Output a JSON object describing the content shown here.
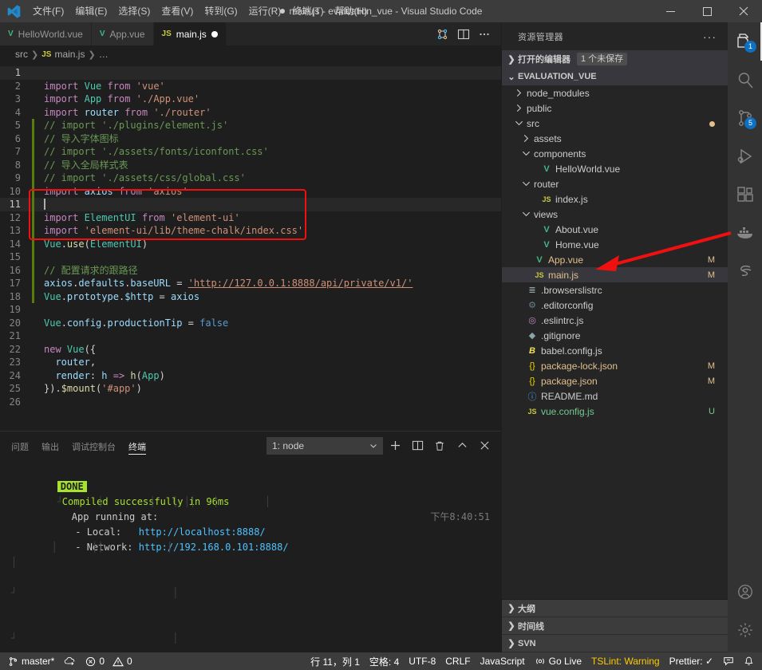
{
  "titlebar": {
    "logo_icon": "vscode-logo-icon",
    "menus": [
      {
        "label": "文件(F)",
        "name": "menu-file"
      },
      {
        "label": "编辑(E)",
        "name": "menu-edit"
      },
      {
        "label": "选择(S)",
        "name": "menu-selection"
      },
      {
        "label": "查看(V)",
        "name": "menu-view"
      },
      {
        "label": "转到(G)",
        "name": "menu-go"
      },
      {
        "label": "运行(R)",
        "name": "menu-run"
      },
      {
        "label": "终端(T)",
        "name": "menu-terminal"
      },
      {
        "label": "帮助(H)",
        "name": "menu-help"
      }
    ],
    "window_title": "main.js - evaluation_vue - Visual Studio Code",
    "minimize_label": "—",
    "maximize_label": "▢",
    "close_label": "✕"
  },
  "tabs": [
    {
      "label": "HelloWorld.vue",
      "type": "vue",
      "type_label": "V",
      "active": false,
      "dirty": false
    },
    {
      "label": "App.vue",
      "type": "vue",
      "type_label": "V",
      "active": false,
      "dirty": false
    },
    {
      "label": "main.js",
      "type": "js",
      "type_label": "JS",
      "active": true,
      "dirty": true
    }
  ],
  "tabbar_actions": [
    {
      "name": "run-and-debug-icon",
      "label": "⑂"
    },
    {
      "name": "split-editor-icon",
      "label": "▯"
    },
    {
      "name": "more-actions-icon",
      "label": "···"
    }
  ],
  "breadcrumb": {
    "items": [
      "src",
      "main.js",
      "…"
    ],
    "file_type_label": "JS",
    "separator": "❯"
  },
  "editor": {
    "language": "JavaScript",
    "lines": [
      {
        "n": 1,
        "mark": "none",
        "current": true,
        "tokens": []
      },
      {
        "n": 2,
        "mark": "none",
        "tokens": [
          {
            "t": "kw",
            "v": "import"
          },
          {
            "t": "op",
            "v": " "
          },
          {
            "t": "cls",
            "v": "Vue"
          },
          {
            "t": "op",
            "v": " "
          },
          {
            "t": "kw",
            "v": "from"
          },
          {
            "t": "op",
            "v": " "
          },
          {
            "t": "str",
            "v": "'vue'"
          }
        ]
      },
      {
        "n": 3,
        "mark": "none",
        "tokens": [
          {
            "t": "kw",
            "v": "import"
          },
          {
            "t": "op",
            "v": " "
          },
          {
            "t": "cls",
            "v": "App"
          },
          {
            "t": "op",
            "v": " "
          },
          {
            "t": "kw",
            "v": "from"
          },
          {
            "t": "op",
            "v": " "
          },
          {
            "t": "str",
            "v": "'./App.vue'"
          }
        ]
      },
      {
        "n": 4,
        "mark": "none",
        "tokens": [
          {
            "t": "kw",
            "v": "import"
          },
          {
            "t": "op",
            "v": " "
          },
          {
            "t": "id",
            "v": "router"
          },
          {
            "t": "op",
            "v": " "
          },
          {
            "t": "kw",
            "v": "from"
          },
          {
            "t": "op",
            "v": " "
          },
          {
            "t": "str",
            "v": "'./router'"
          }
        ]
      },
      {
        "n": 5,
        "mark": "green",
        "tokens": [
          {
            "t": "cmt",
            "v": "// import './plugins/element.js'"
          }
        ]
      },
      {
        "n": 6,
        "mark": "green",
        "tokens": [
          {
            "t": "cmt",
            "v": "// 导入字体图标"
          }
        ]
      },
      {
        "n": 7,
        "mark": "green",
        "tokens": [
          {
            "t": "cmt",
            "v": "// import './assets/fonts/iconfont.css'"
          }
        ]
      },
      {
        "n": 8,
        "mark": "green",
        "tokens": [
          {
            "t": "cmt",
            "v": "// 导入全局样式表"
          }
        ]
      },
      {
        "n": 9,
        "mark": "green",
        "tokens": [
          {
            "t": "cmt",
            "v": "// import './assets/css/global.css'"
          }
        ]
      },
      {
        "n": 10,
        "mark": "green",
        "tokens": [
          {
            "t": "kw",
            "v": "import"
          },
          {
            "t": "op",
            "v": " "
          },
          {
            "t": "id",
            "v": "axios"
          },
          {
            "t": "op",
            "v": " "
          },
          {
            "t": "kw",
            "v": "from"
          },
          {
            "t": "op",
            "v": " "
          },
          {
            "t": "str",
            "v": "'axios'"
          }
        ]
      },
      {
        "n": 11,
        "mark": "green",
        "current": true,
        "tokens": []
      },
      {
        "n": 12,
        "mark": "green",
        "tokens": [
          {
            "t": "kw",
            "v": "import"
          },
          {
            "t": "op",
            "v": " "
          },
          {
            "t": "cls",
            "v": "ElementUI"
          },
          {
            "t": "op",
            "v": " "
          },
          {
            "t": "kw",
            "v": "from"
          },
          {
            "t": "op",
            "v": " "
          },
          {
            "t": "str",
            "v": "'element-ui'"
          }
        ]
      },
      {
        "n": 13,
        "mark": "green",
        "tokens": [
          {
            "t": "kw",
            "v": "import"
          },
          {
            "t": "op",
            "v": " "
          },
          {
            "t": "str",
            "v": "'element-ui/lib/theme-chalk/index.css'"
          }
        ]
      },
      {
        "n": 14,
        "mark": "green",
        "tokens": [
          {
            "t": "cls",
            "v": "Vue"
          },
          {
            "t": "op",
            "v": "."
          },
          {
            "t": "fn",
            "v": "use"
          },
          {
            "t": "op",
            "v": "("
          },
          {
            "t": "cls",
            "v": "ElementUI"
          },
          {
            "t": "op",
            "v": ")"
          }
        ]
      },
      {
        "n": 15,
        "mark": "green",
        "tokens": []
      },
      {
        "n": 16,
        "mark": "green",
        "tokens": [
          {
            "t": "cmt",
            "v": "// 配置请求的跟路径"
          }
        ]
      },
      {
        "n": 17,
        "mark": "green",
        "tokens": [
          {
            "t": "id",
            "v": "axios"
          },
          {
            "t": "op",
            "v": "."
          },
          {
            "t": "prop",
            "v": "defaults"
          },
          {
            "t": "op",
            "v": "."
          },
          {
            "t": "prop",
            "v": "baseURL"
          },
          {
            "t": "op",
            "v": " = "
          },
          {
            "t": "link",
            "v": "'http://127.0.0.1:8888/api/private/v1/'"
          }
        ]
      },
      {
        "n": 18,
        "mark": "green",
        "tokens": [
          {
            "t": "cls",
            "v": "Vue"
          },
          {
            "t": "op",
            "v": "."
          },
          {
            "t": "prop",
            "v": "prototype"
          },
          {
            "t": "op",
            "v": "."
          },
          {
            "t": "prop",
            "v": "$http"
          },
          {
            "t": "op",
            "v": " = "
          },
          {
            "t": "id",
            "v": "axios"
          }
        ]
      },
      {
        "n": 19,
        "mark": "none",
        "tokens": []
      },
      {
        "n": 20,
        "mark": "none",
        "tokens": [
          {
            "t": "cls",
            "v": "Vue"
          },
          {
            "t": "op",
            "v": "."
          },
          {
            "t": "prop",
            "v": "config"
          },
          {
            "t": "op",
            "v": "."
          },
          {
            "t": "prop",
            "v": "productionTip"
          },
          {
            "t": "op",
            "v": " = "
          },
          {
            "t": "kw2",
            "v": "false"
          }
        ]
      },
      {
        "n": 21,
        "mark": "none",
        "tokens": []
      },
      {
        "n": 22,
        "mark": "none",
        "tokens": [
          {
            "t": "kw",
            "v": "new"
          },
          {
            "t": "op",
            "v": " "
          },
          {
            "t": "cls",
            "v": "Vue"
          },
          {
            "t": "op",
            "v": "({"
          }
        ]
      },
      {
        "n": 23,
        "mark": "none",
        "tokens": [
          {
            "t": "op",
            "v": "  "
          },
          {
            "t": "id",
            "v": "router"
          },
          {
            "t": "op",
            "v": ","
          }
        ]
      },
      {
        "n": 24,
        "mark": "none",
        "tokens": [
          {
            "t": "op",
            "v": "  "
          },
          {
            "t": "prop",
            "v": "render"
          },
          {
            "t": "op",
            "v": ": "
          },
          {
            "t": "id",
            "v": "h"
          },
          {
            "t": "op",
            "v": " "
          },
          {
            "t": "kw",
            "v": "=>"
          },
          {
            "t": "op",
            "v": " "
          },
          {
            "t": "fn",
            "v": "h"
          },
          {
            "t": "op",
            "v": "("
          },
          {
            "t": "cls",
            "v": "App"
          },
          {
            "t": "op",
            "v": ")"
          }
        ]
      },
      {
        "n": 25,
        "mark": "none",
        "tokens": [
          {
            "t": "op",
            "v": "})."
          },
          {
            "t": "fn",
            "v": "$mount"
          },
          {
            "t": "op",
            "v": "("
          },
          {
            "t": "str",
            "v": "'#app'"
          },
          {
            "t": "op",
            "v": ")"
          }
        ]
      },
      {
        "n": 26,
        "mark": "none",
        "tokens": []
      }
    ],
    "highlight_annotation": {
      "color": "#f01010",
      "from_line": 11,
      "to_line": 15
    }
  },
  "sidebar": {
    "title": "资源管理器",
    "more_label": "···",
    "open_editors": {
      "label": "打开的编辑器",
      "badge": "1 个未保存",
      "chevron": "❯"
    },
    "workspace": {
      "label": "EVALUATION_VUE",
      "chevron": "⌄"
    },
    "tree": [
      {
        "name": "node_modules",
        "indent": 1,
        "kind": "folder",
        "open": false,
        "icon": "folder-icon"
      },
      {
        "name": "public",
        "indent": 1,
        "kind": "folder",
        "open": false,
        "icon": "folder-icon"
      },
      {
        "name": "src",
        "indent": 1,
        "kind": "folder",
        "open": true,
        "icon": "folder-icon",
        "dot": true
      },
      {
        "name": "assets",
        "indent": 2,
        "kind": "folder",
        "open": false,
        "icon": "folder-icon"
      },
      {
        "name": "components",
        "indent": 2,
        "kind": "folder",
        "open": true,
        "icon": "folder-icon"
      },
      {
        "name": "HelloWorld.vue",
        "indent": 3,
        "kind": "file",
        "icon": "vue-file-icon",
        "icon_label": "V"
      },
      {
        "name": "router",
        "indent": 2,
        "kind": "folder",
        "open": true,
        "icon": "folder-icon"
      },
      {
        "name": "index.js",
        "indent": 3,
        "kind": "file",
        "icon": "js-file-icon",
        "icon_label": "JS"
      },
      {
        "name": "views",
        "indent": 2,
        "kind": "folder",
        "open": true,
        "icon": "folder-icon"
      },
      {
        "name": "About.vue",
        "indent": 3,
        "kind": "file",
        "icon": "vue-file-icon",
        "icon_label": "V"
      },
      {
        "name": "Home.vue",
        "indent": 3,
        "kind": "file",
        "icon": "vue-file-icon",
        "icon_label": "V"
      },
      {
        "name": "App.vue",
        "indent": 2,
        "kind": "file",
        "icon": "vue-file-icon",
        "icon_label": "V",
        "status": "M",
        "status_color": "modified"
      },
      {
        "name": "main.js",
        "indent": 2,
        "kind": "file",
        "icon": "js-file-icon",
        "icon_label": "JS",
        "status": "M",
        "status_color": "modified",
        "selected": true
      },
      {
        "name": ".browserslistrc",
        "indent": 1,
        "kind": "file",
        "icon": "list-file-icon",
        "icon_label": "≣"
      },
      {
        "name": ".editorconfig",
        "indent": 1,
        "kind": "file",
        "icon": "gear-file-icon",
        "icon_label": "⚙"
      },
      {
        "name": ".eslintrc.js",
        "indent": 1,
        "kind": "file",
        "icon": "eslint-file-icon",
        "icon_label": "◎"
      },
      {
        "name": ".gitignore",
        "indent": 1,
        "kind": "file",
        "icon": "git-file-icon",
        "icon_label": "◆"
      },
      {
        "name": "babel.config.js",
        "indent": 1,
        "kind": "file",
        "icon": "babel-file-icon",
        "icon_label": "B"
      },
      {
        "name": "package-lock.json",
        "indent": 1,
        "kind": "file",
        "icon": "json-file-icon",
        "icon_label": "{}",
        "status": "M",
        "status_color": "modified"
      },
      {
        "name": "package.json",
        "indent": 1,
        "kind": "file",
        "icon": "json-file-icon",
        "icon_label": "{}",
        "status": "M",
        "status_color": "modified"
      },
      {
        "name": "README.md",
        "indent": 1,
        "kind": "file",
        "icon": "info-file-icon",
        "icon_label": "ⓘ"
      },
      {
        "name": "vue.config.js",
        "indent": 1,
        "kind": "file",
        "icon": "js-file-icon",
        "icon_label": "JS",
        "status": "U",
        "status_color": "untracked"
      }
    ],
    "bottom_panels": [
      {
        "label": "大纲",
        "chevron": "❯",
        "name": "outline-panel"
      },
      {
        "label": "时间线",
        "chevron": "❯",
        "name": "timeline-panel"
      },
      {
        "label": "SVN",
        "chevron": "❯",
        "name": "svn-panel"
      }
    ]
  },
  "activitybar": {
    "items": [
      {
        "name": "explorer-icon",
        "badge": "1",
        "active": true
      },
      {
        "name": "search-icon",
        "badge": null,
        "active": false
      },
      {
        "name": "source-control-icon",
        "badge": "5",
        "active": false
      },
      {
        "name": "run-and-debug-icon",
        "badge": null,
        "active": false
      },
      {
        "name": "extensions-icon",
        "badge": null,
        "active": false
      },
      {
        "name": "docker-icon",
        "badge": null,
        "active": false
      },
      {
        "name": "sass-icon",
        "badge": null,
        "active": false
      }
    ],
    "bottom_items": [
      {
        "name": "accounts-icon"
      },
      {
        "name": "settings-gear-icon"
      }
    ]
  },
  "panel": {
    "tabs": [
      {
        "label": "问题",
        "active": false,
        "name": "tab-problems"
      },
      {
        "label": "输出",
        "active": false,
        "name": "tab-output"
      },
      {
        "label": "调试控制台",
        "active": false,
        "name": "tab-debug-console"
      },
      {
        "label": "终端",
        "active": true,
        "name": "tab-terminal"
      }
    ],
    "terminal_select": {
      "value": "1: node",
      "chevron": "⌄"
    },
    "actions": [
      {
        "name": "new-terminal-icon",
        "label": "+"
      },
      {
        "name": "split-terminal-icon",
        "label": "▯"
      },
      {
        "name": "kill-terminal-icon",
        "label": "🗑"
      },
      {
        "name": "maximize-panel-icon",
        "label": "^"
      },
      {
        "name": "close-panel-icon",
        "label": "✕"
      }
    ],
    "terminal": {
      "done_badge": "DONE",
      "compiled_message": "Compiled successfully in 96ms",
      "timestamp": "下午8:40:51",
      "app_running_label": "App running at:",
      "local_label": "  - Local:   ",
      "local_url": "http://localhost:8888/",
      "network_label": "  - Network: ",
      "network_url": "http://192.168.0.101:8888/"
    }
  },
  "statusbar": {
    "left": [
      {
        "name": "remote-branch",
        "icon": "source-control-icon",
        "label": "master*"
      },
      {
        "name": "sync-changes",
        "icon": "sync-cloud-icon",
        "label": ""
      },
      {
        "name": "problems-errors",
        "icon": "error-icon",
        "label": "0"
      },
      {
        "name": "problems-warnings",
        "icon": "warning-icon",
        "label": "0"
      }
    ],
    "right": [
      {
        "name": "cursor-position",
        "label": "行 11，列 1"
      },
      {
        "name": "indentation",
        "label": "空格: 4"
      },
      {
        "name": "encoding",
        "label": "UTF-8"
      },
      {
        "name": "eol",
        "label": "CRLF"
      },
      {
        "name": "language-mode",
        "label": "JavaScript"
      },
      {
        "name": "go-live",
        "icon": "broadcast-icon",
        "label": "Go Live"
      },
      {
        "name": "tslint-status",
        "label": "TSLint: Warning",
        "warn": true
      },
      {
        "name": "prettier-status",
        "label": "Prettier: ✓"
      },
      {
        "name": "feedback-icon",
        "label": ""
      },
      {
        "name": "notifications-bell-icon",
        "label": ""
      }
    ]
  },
  "colors": {
    "accent": "#0e70c0",
    "titlebar_bg": "#3c3c3c",
    "editor_bg": "#1e1e1e",
    "sidebar_bg": "#252526",
    "annotation_red": "#f01010",
    "modified_yellow": "#e2c08d",
    "untracked_green": "#73c991",
    "warn_yellow": "#ffcc00"
  }
}
